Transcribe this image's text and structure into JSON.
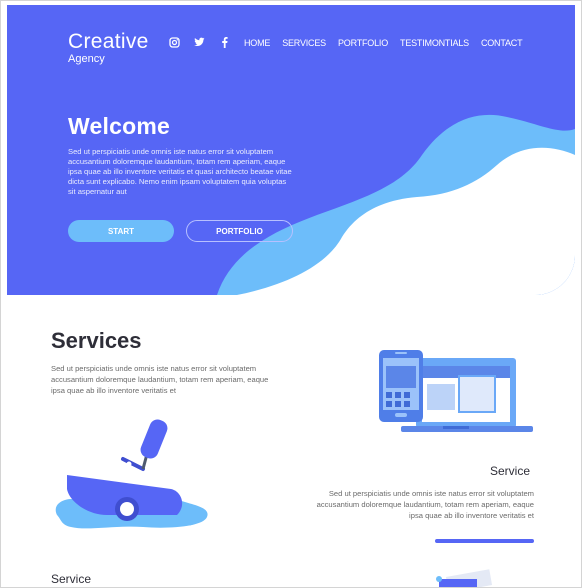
{
  "brand": {
    "title": "Creative",
    "subtitle": "Agency"
  },
  "social": [
    {
      "icon": "instagram-icon",
      "glyph": "◎"
    },
    {
      "icon": "twitter-icon",
      "glyph": "❦"
    },
    {
      "icon": "facebook-icon",
      "glyph": "f"
    }
  ],
  "nav": {
    "items": [
      "HOME",
      "SERVICES",
      "PORTFOLIO",
      "TESTIMONTIALS",
      "CONTACT"
    ]
  },
  "hero": {
    "title": "Welcome",
    "text": "Sed ut perspiciatis unde omnis iste natus error sit voluptatem accusantium doloremque laudantium, totam rem aperiam, eaque ipsa quae ab illo inventore veritatis et quasi architecto beatae vitae dicta sunt explicabo. Nemo enim ipsam voluptatem quia voluptas sit aspernatur aut",
    "start_label": "START",
    "portfolio_label": "PORTFOLIO"
  },
  "services": {
    "title": "Services",
    "text": "Sed ut perspiciatis unde omnis iste natus error sit voluptatem accusantium doloremque laudantium, totam rem aperiam, eaque ipsa quae ab illo inventore veritatis et",
    "item1": {
      "title": "Service",
      "text": "Sed ut perspiciatis unde omnis iste natus error sit voluptatem accusantium doloremque laudantium, totam rem aperiam, eaque ipsa quae ab illo inventore veritatis et"
    },
    "item2": {
      "title": "Service"
    }
  },
  "colors": {
    "primary": "#5666f5",
    "accent": "#6dbdfa",
    "text_dark": "#2e2e38"
  }
}
